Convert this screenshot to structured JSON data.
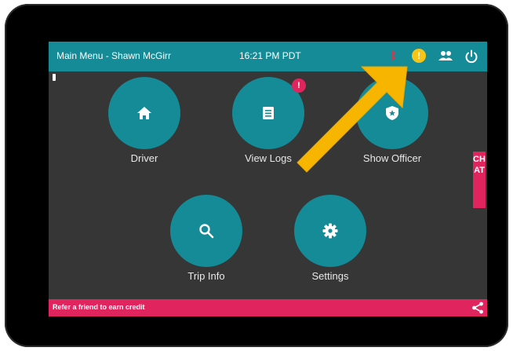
{
  "header": {
    "title": "Main Menu - Shawn McGirr",
    "time": "16:21 PM PDT",
    "warning_glyph": "!"
  },
  "menu": {
    "driver": "Driver",
    "view_logs": "View Logs",
    "view_logs_badge": "!",
    "show_officer": "Show Officer",
    "trip_info": "Trip Info",
    "settings": "Settings"
  },
  "chat": {
    "label": "CHAT"
  },
  "footer": {
    "refer": "Refer a friend to earn credit"
  },
  "colors": {
    "teal": "#148b96",
    "pink": "#e0245e",
    "background": "#363636",
    "warning": "#f6c518",
    "arrow": "#f7b500"
  },
  "icons": [
    "bluetooth-icon",
    "warning-icon",
    "people-icon",
    "power-icon",
    "home-icon",
    "logs-icon",
    "officer-badge-icon",
    "search-icon",
    "gear-icon",
    "share-icon"
  ]
}
